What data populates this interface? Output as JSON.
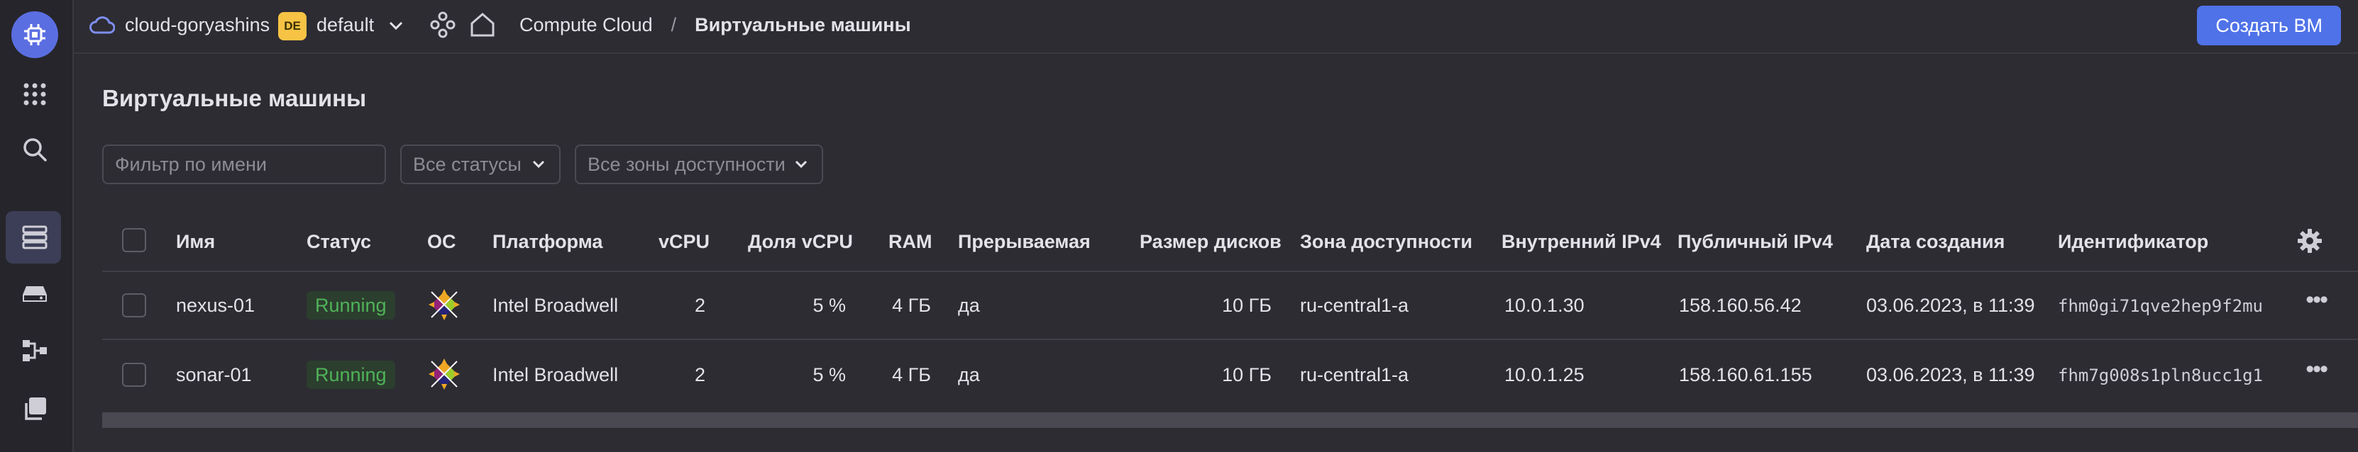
{
  "header": {
    "cloud_name": "cloud-goryashins",
    "folder_badge": "DE",
    "folder_name": "default",
    "breadcrumb_root": "Compute Cloud",
    "breadcrumb_sep": "/",
    "breadcrumb_current": "Виртуальные машины",
    "create_button": "Создать ВМ"
  },
  "rail": {
    "icons": [
      "compute-logo-icon",
      "apps-grid-icon",
      "search-icon",
      "vm-servers-icon",
      "disk-icon",
      "network-icon",
      "copy-icon"
    ]
  },
  "page": {
    "title": "Виртуальные машины",
    "filter_placeholder": "Фильтр по имени",
    "status_select": "Все статусы",
    "zone_select": "Все зоны доступности"
  },
  "table": {
    "columns": {
      "name": "Имя",
      "status": "Статус",
      "os": "ОС",
      "platform": "Платформа",
      "vcpu": "vCPU",
      "vcpu_share": "Доля vCPU",
      "ram": "RAM",
      "preemptible": "Прерываемая",
      "disk_size": "Размер дисков",
      "zone": "Зона доступности",
      "internal_ip": "Внутренний IPv4",
      "public_ip": "Публичный IPv4",
      "created": "Дата создания",
      "id": "Идентификатор"
    },
    "rows": [
      {
        "name": "nexus-01",
        "status": "Running",
        "os_icon": "centos-logo-icon",
        "platform": "Intel Broadwell",
        "vcpu": "2",
        "vcpu_share": "5 %",
        "ram": "4 ГБ",
        "preemptible": "да",
        "disk_size": "10 ГБ",
        "zone": "ru-central1-a",
        "internal_ip": "10.0.1.30",
        "public_ip": "158.160.56.42",
        "created": "03.06.2023, в 11:39",
        "id": "fhm0gi71qve2hep9f2mu"
      },
      {
        "name": "sonar-01",
        "status": "Running",
        "os_icon": "centos-logo-icon",
        "platform": "Intel Broadwell",
        "vcpu": "2",
        "vcpu_share": "5 %",
        "ram": "4 ГБ",
        "preemptible": "да",
        "disk_size": "10 ГБ",
        "zone": "ru-central1-a",
        "internal_ip": "10.0.1.25",
        "public_ip": "158.160.61.155",
        "created": "03.06.2023, в 11:39",
        "id": "fhm7g008s1pln8ucc1g1"
      }
    ]
  },
  "colors": {
    "background": "#2d2c33",
    "accent": "#4f72e8",
    "status_running": "#4fb359",
    "folder_badge": "#f6c344"
  }
}
